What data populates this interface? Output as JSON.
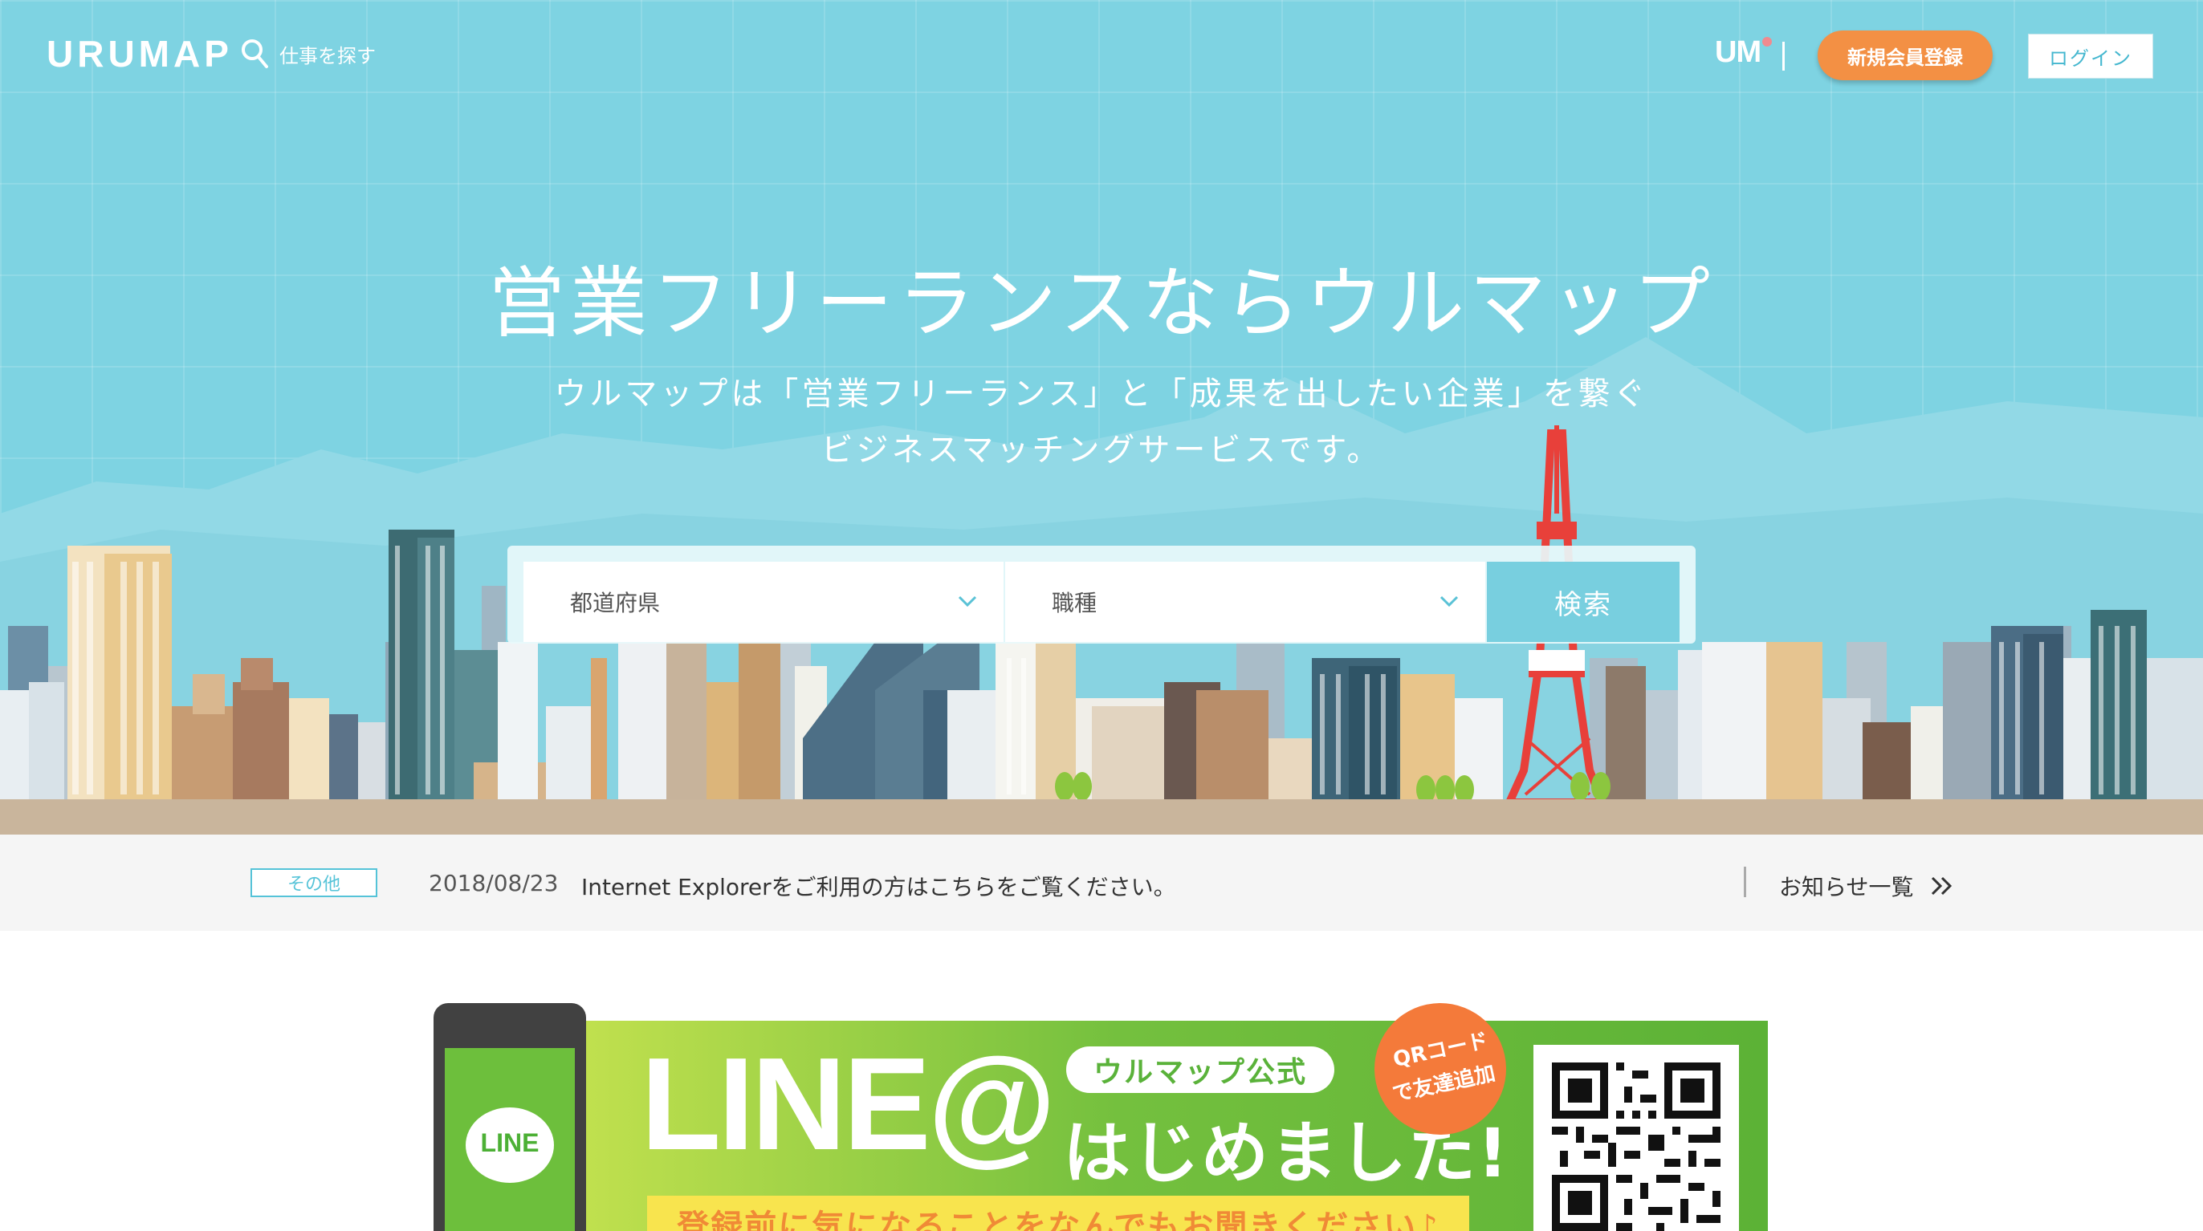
{
  "header": {
    "logo": "URUMAP",
    "search_link": "仕事を探す",
    "um_mark": "UM",
    "register_button": "新規会員登録",
    "login_button": "ログイン"
  },
  "hero": {
    "title": "営業フリーランスならウルマップ",
    "subtitle_line1": "ウルマップは「営業フリーランス」と「成果を出したい企業」を繋ぐ",
    "subtitle_line2": "ビジネスマッチングサービスです。"
  },
  "search": {
    "prefecture_label": "都道府県",
    "job_label": "職種",
    "submit_label": "検索"
  },
  "news": {
    "tag": "その他",
    "date": "2018/08/23",
    "text": "Internet Explorerをご利用の方はこちらをご覧ください。",
    "all_link": "お知らせ一覧"
  },
  "banner": {
    "phone_label": "LINE",
    "headline": "LINE@",
    "pill": "ウルマップ公式",
    "big_text": "はじめました!",
    "badge_line1": "QRコード",
    "badge_line2": "で友達追加",
    "bottom_text": "登録前に気になることをなんでもお聞きください♪"
  },
  "colors": {
    "sky": "#7ed3e2",
    "accent_orange": "#f39044",
    "accent_cyan": "#55c3d8",
    "line_green": "#5cb236"
  }
}
